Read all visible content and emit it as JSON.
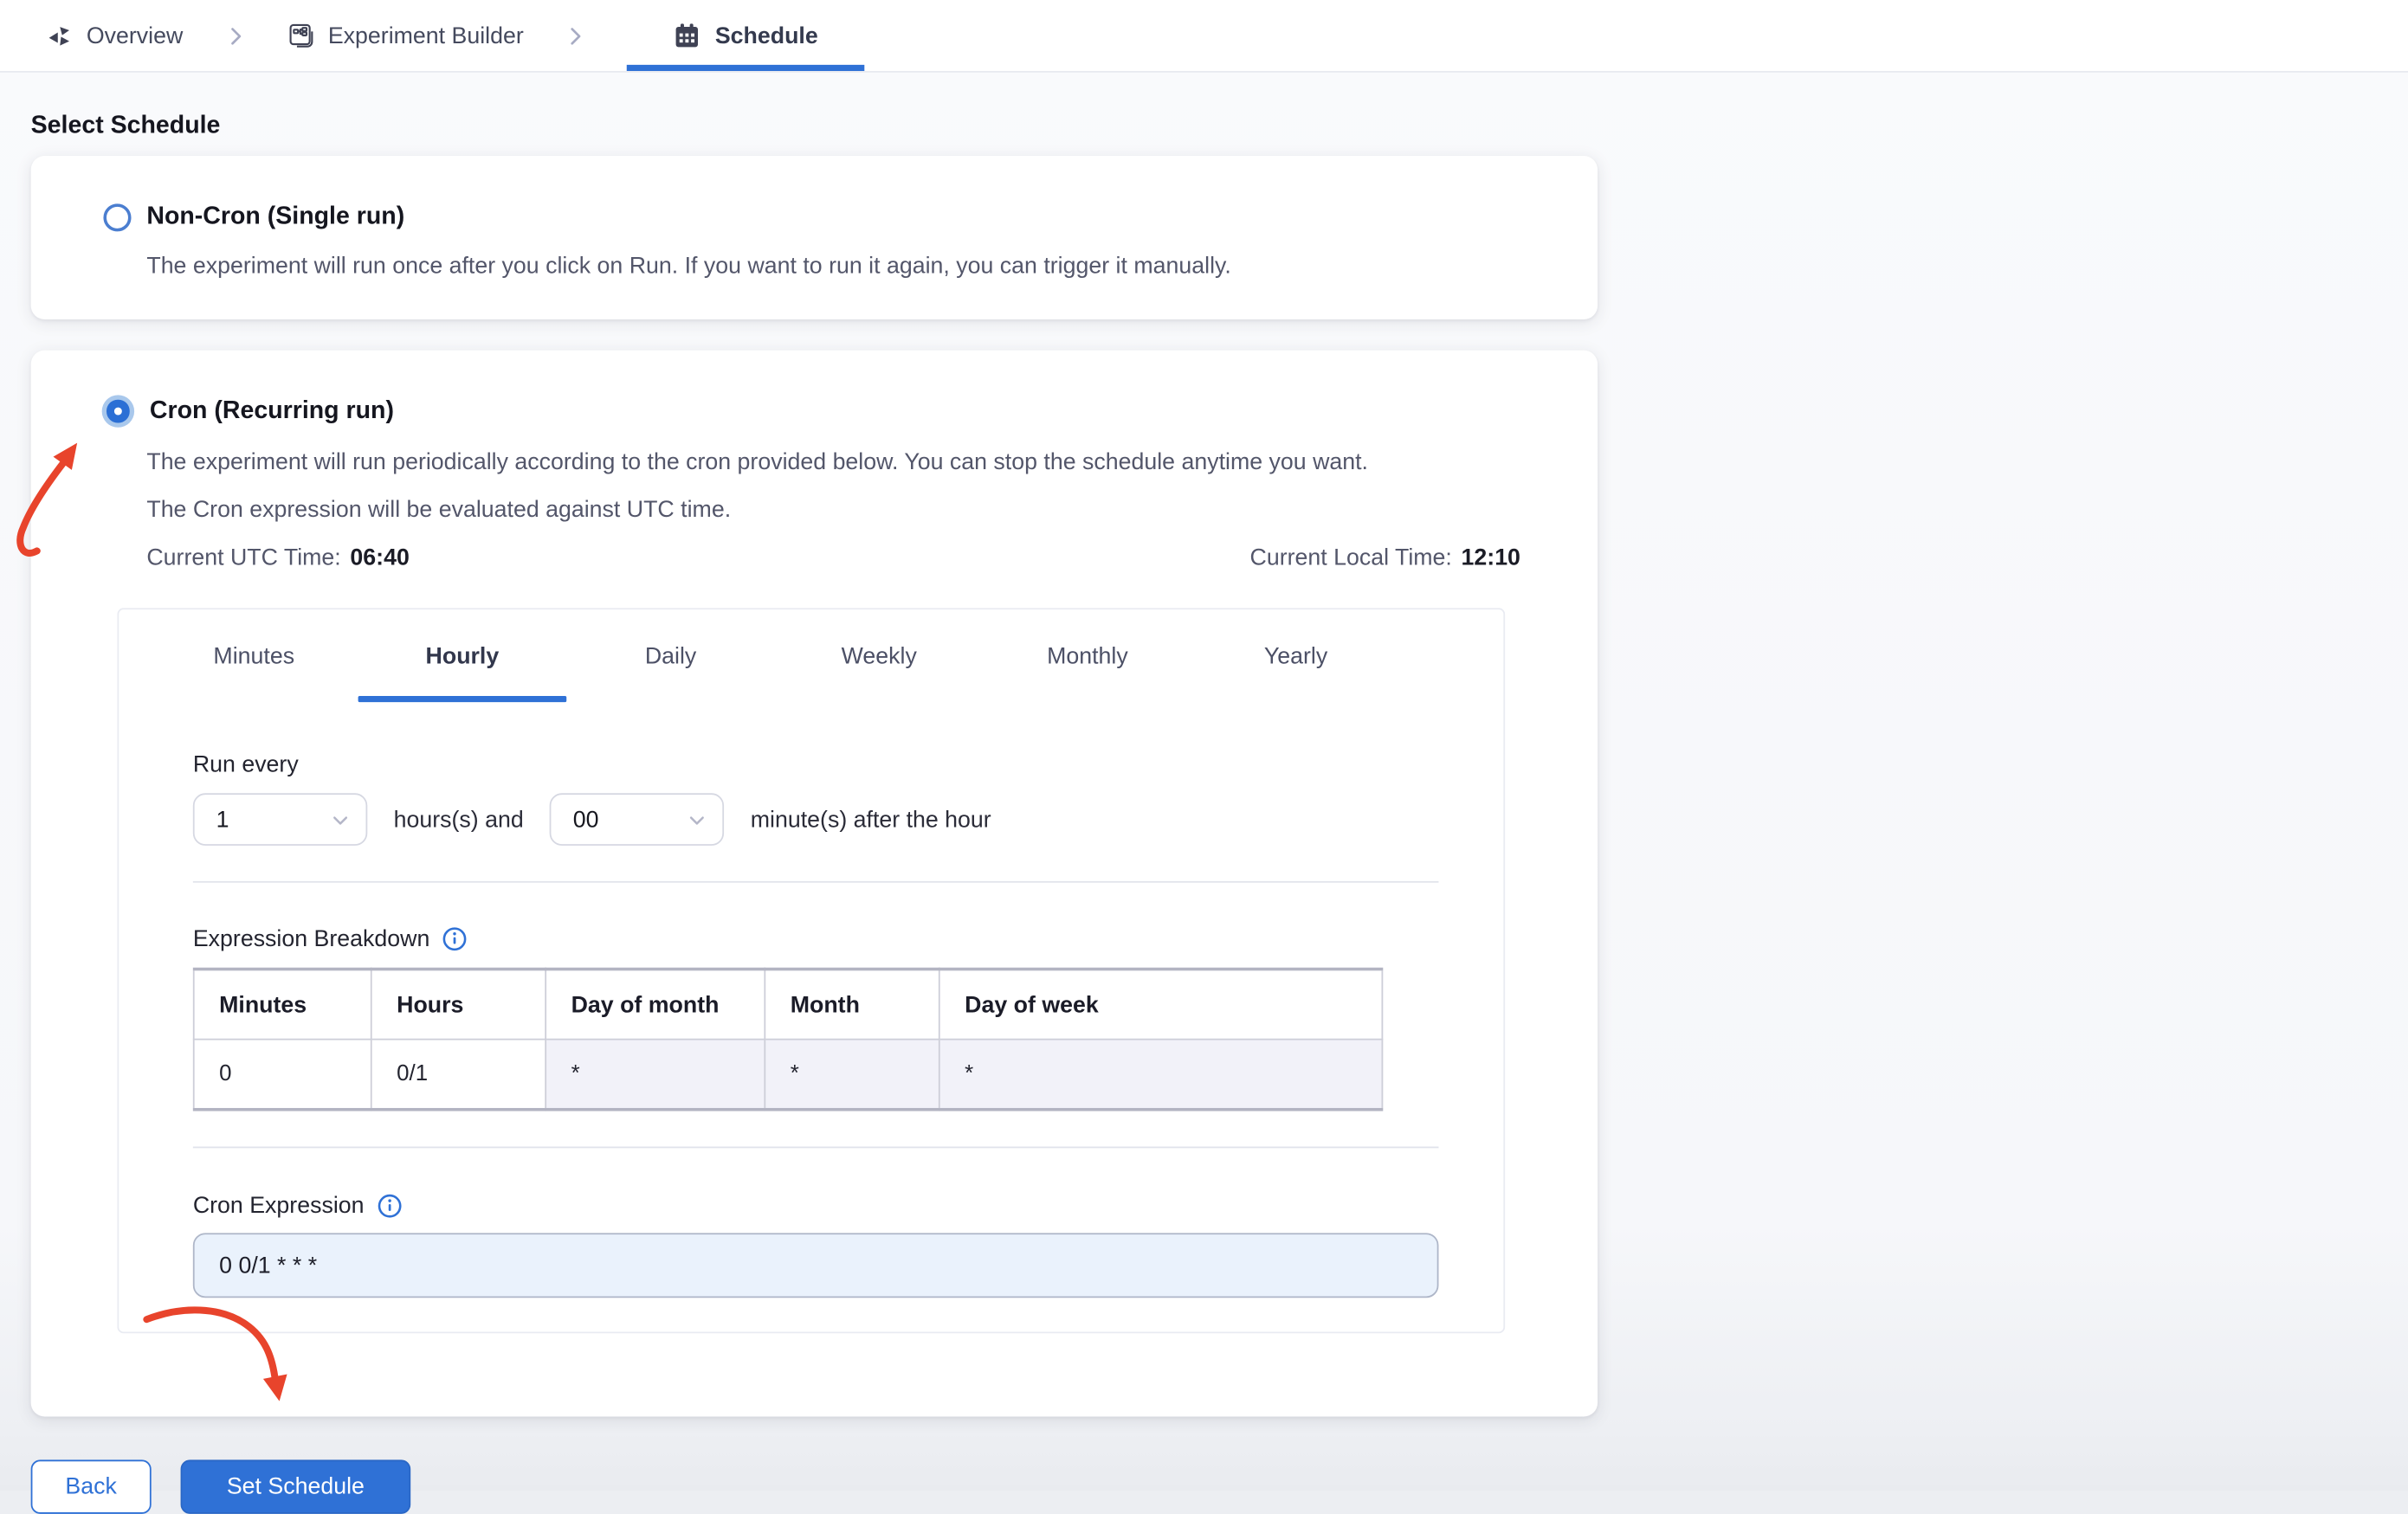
{
  "breadcrumb": {
    "items": [
      {
        "label": "Overview",
        "icon": "overview-pinwheel-icon"
      },
      {
        "label": "Experiment Builder",
        "icon": "experiment-builder-icon"
      },
      {
        "label": "Schedule",
        "icon": "calendar-icon",
        "active": true
      }
    ]
  },
  "page": {
    "heading": "Select Schedule"
  },
  "options": {
    "non_cron": {
      "title": "Non-Cron (Single run)",
      "description": "The experiment will run once after you click on Run. If you want to run it again, you can trigger it manually.",
      "selected": false
    },
    "cron": {
      "title": "Cron (Recurring run)",
      "description_line1": "The experiment will run periodically according to the cron provided below. You can stop the schedule anytime you want.",
      "description_line2": "The Cron expression will be evaluated against UTC time.",
      "utc_time_label": "Current UTC Time:",
      "utc_time_value": "06:40",
      "local_time_label": "Current Local Time:",
      "local_time_value": "12:10",
      "selected": true
    }
  },
  "scheduler": {
    "tabs": [
      "Minutes",
      "Hourly",
      "Daily",
      "Weekly",
      "Monthly",
      "Yearly"
    ],
    "active_tab": "Hourly",
    "run_every_label": "Run every",
    "hours_value": "1",
    "hours_text": "hours(s) and",
    "minutes_value": "00",
    "minutes_text": "minute(s) after the hour",
    "expression_breakdown": {
      "label": "Expression Breakdown",
      "headers": [
        "Minutes",
        "Hours",
        "Day of month",
        "Month",
        "Day of week"
      ],
      "values": [
        "0",
        "0/1",
        "*",
        "*",
        "*"
      ]
    },
    "cron_expression": {
      "label": "Cron Expression",
      "value": "0 0/1 * * *"
    }
  },
  "footer": {
    "back_label": "Back",
    "submit_label": "Set Schedule"
  },
  "colors": {
    "accent_blue": "#2f71d6",
    "annotation_red": "#e8442c",
    "input_background": "#eaf2fc",
    "table_shade": "#f2f2f9"
  }
}
